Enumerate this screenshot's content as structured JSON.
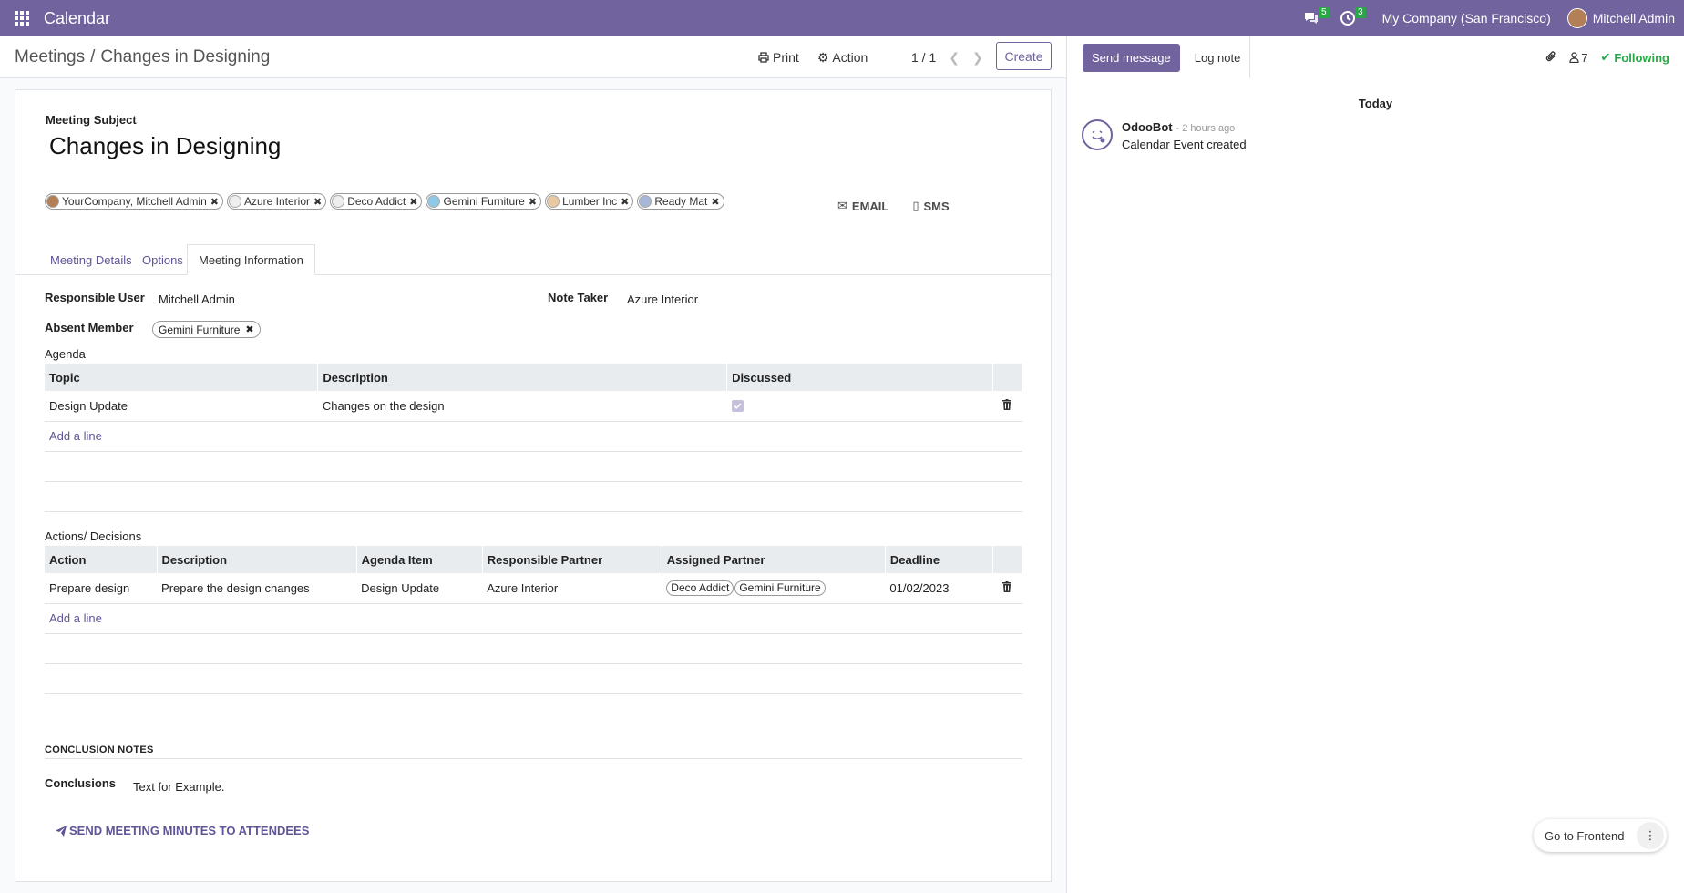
{
  "app": {
    "title": "Calendar"
  },
  "navbar": {
    "messages_count": "5",
    "activities_count": "3",
    "company": "My Company (San Francisco)",
    "user": "Mitchell Admin"
  },
  "breadcrumb": {
    "parent": "Meetings",
    "separator": "/",
    "current": "Changes in Designing"
  },
  "control_panel": {
    "print_label": "Print",
    "action_label": "Action",
    "pager": "1 / 1",
    "create_label": "Create"
  },
  "form": {
    "subject_label": "Meeting Subject",
    "subject": "Changes in Designing",
    "attendees": [
      {
        "name": "YourCompany, Mitchell Admin"
      },
      {
        "name": "Azure Interior"
      },
      {
        "name": "Deco Addict"
      },
      {
        "name": "Gemini Furniture"
      },
      {
        "name": "Lumber Inc"
      },
      {
        "name": "Ready Mat"
      }
    ],
    "email_label": "EMAIL",
    "sms_label": "SMS",
    "tabs": [
      "Meeting Details",
      "Options",
      "Meeting Information"
    ],
    "responsible_user_label": "Responsible User",
    "responsible_user": "Mitchell Admin",
    "note_taker_label": "Note Taker",
    "note_taker": "Azure Interior",
    "absent_member_label": "Absent Member",
    "absent_member": "Gemini Furniture",
    "agenda_label": "Agenda",
    "agenda_columns": [
      "Topic",
      "Description",
      "Discussed"
    ],
    "agenda_rows": [
      {
        "topic": "Design Update",
        "description": "Changes on the design",
        "discussed": true
      }
    ],
    "add_line_label": "Add a line",
    "actions_label": "Actions/ Decisions",
    "actions_columns": [
      "Action",
      "Description",
      "Agenda Item",
      "Responsible Partner",
      "Assigned Partner",
      "Deadline"
    ],
    "actions_rows": [
      {
        "action": "Prepare design",
        "description": "Prepare the design changes",
        "agenda_item": "Design Update",
        "responsible": "Azure Interior",
        "assigned": [
          "Deco Addict",
          "Gemini Furniture"
        ],
        "deadline": "01/02/2023"
      }
    ],
    "conclusion_head": "CONCLUSION NOTES",
    "conclusions_label": "Conclusions",
    "conclusions": "Text for Example.",
    "send_minutes_label": "SEND MEETING MINUTES TO ATTENDEES"
  },
  "chatter": {
    "send_message_label": "Send message",
    "log_note_label": "Log note",
    "followers_count": "7",
    "following_label": "Following",
    "day_label": "Today",
    "messages": [
      {
        "author": "OdooBot",
        "ago": "- 2 hours ago",
        "text": "Calendar Event created"
      }
    ],
    "frontend_label": "Go to Frontend"
  },
  "colors": {
    "brand": "#71639e",
    "success": "#28a745"
  }
}
